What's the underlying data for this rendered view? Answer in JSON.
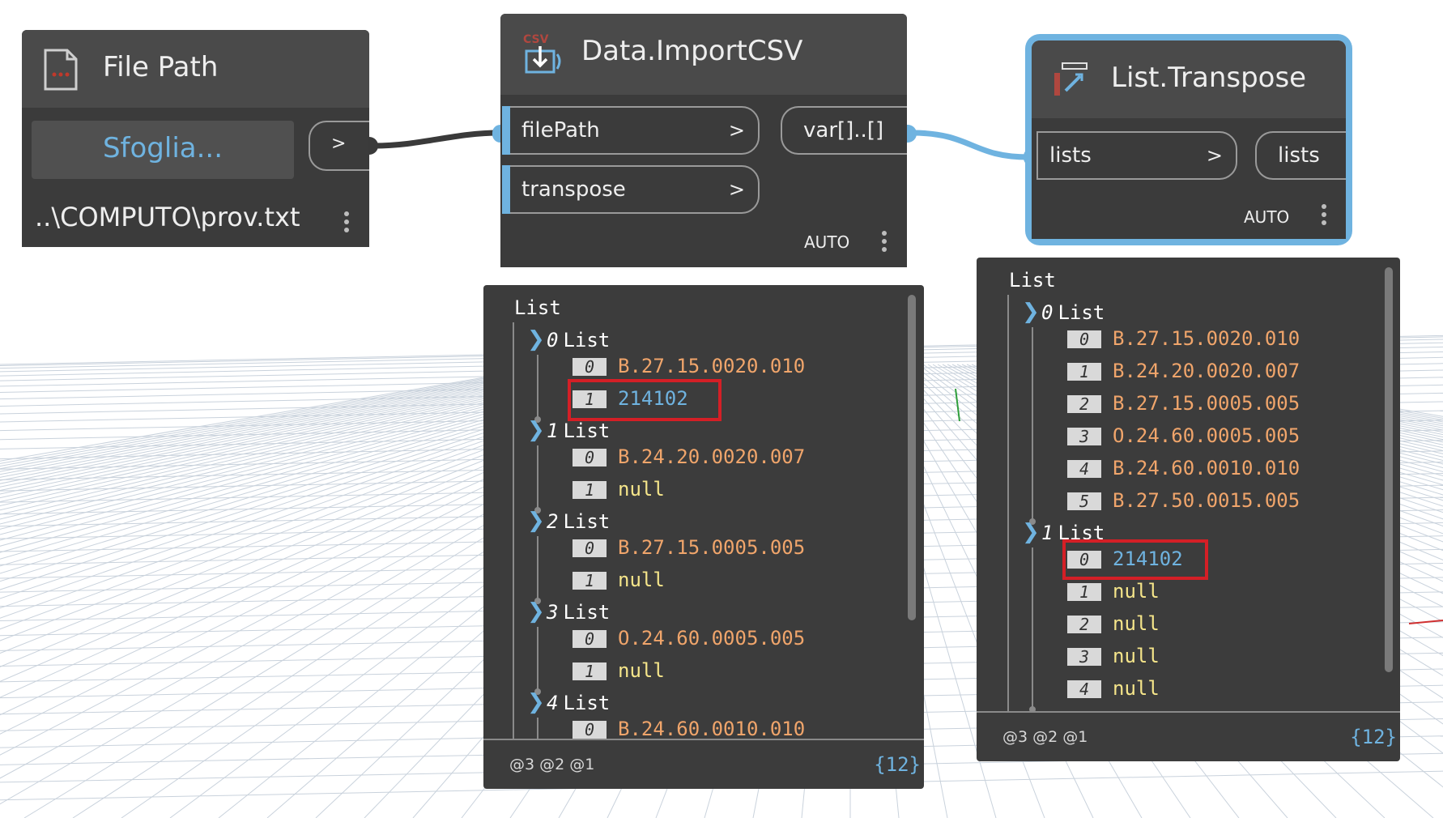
{
  "colors": {
    "node_body": "#3b3b3b",
    "node_header": "#4a4a4a",
    "selected_outline": "#6fb3e0",
    "string_value": "#f0a56b",
    "number_value": "#6fb3e0",
    "null_value": "#f5e58a",
    "highlight_box": "#d41f26"
  },
  "file_path_node": {
    "icon": "file-icon",
    "title": "File Path",
    "browse_button": "Sfoglia...",
    "output_chevron": ">",
    "path_value": "..\\COMPUTO\\prov.txt"
  },
  "import_csv_node": {
    "icon": "csv-import-icon",
    "icon_label": "CSV",
    "title": "Data.ImportCSV",
    "inputs": [
      {
        "name": "filePath",
        "chevron": ">"
      },
      {
        "name": "transpose",
        "chevron": ">"
      }
    ],
    "output": "var[]..[]",
    "lacing": "AUTO"
  },
  "transpose_node": {
    "icon": "list-transpose-icon",
    "title": "List.Transpose",
    "input": {
      "name": "lists",
      "chevron": ">"
    },
    "output": "lists",
    "lacing": "AUTO"
  },
  "import_preview": {
    "root_label": "List",
    "sublists": [
      {
        "index": "0",
        "label": "List",
        "items": [
          {
            "index": "0",
            "value": "B.27.15.0020.010",
            "kind": "string"
          },
          {
            "index": "1",
            "value": "214102",
            "kind": "number"
          }
        ]
      },
      {
        "index": "1",
        "label": "List",
        "items": [
          {
            "index": "0",
            "value": "B.24.20.0020.007",
            "kind": "string"
          },
          {
            "index": "1",
            "value": "null",
            "kind": "null"
          }
        ]
      },
      {
        "index": "2",
        "label": "List",
        "items": [
          {
            "index": "0",
            "value": "B.27.15.0005.005",
            "kind": "string"
          },
          {
            "index": "1",
            "value": "null",
            "kind": "null"
          }
        ]
      },
      {
        "index": "3",
        "label": "List",
        "items": [
          {
            "index": "0",
            "value": "O.24.60.0005.005",
            "kind": "string"
          },
          {
            "index": "1",
            "value": "null",
            "kind": "null"
          }
        ]
      },
      {
        "index": "4",
        "label": "List",
        "items": [
          {
            "index": "0",
            "value": "B.24.60.0010.010",
            "kind": "string"
          }
        ]
      }
    ],
    "levels": "@3 @2 @1",
    "count": "{12}"
  },
  "transpose_preview": {
    "root_label": "List",
    "sublists": [
      {
        "index": "0",
        "label": "List",
        "items": [
          {
            "index": "0",
            "value": "B.27.15.0020.010",
            "kind": "string"
          },
          {
            "index": "1",
            "value": "B.24.20.0020.007",
            "kind": "string"
          },
          {
            "index": "2",
            "value": "B.27.15.0005.005",
            "kind": "string"
          },
          {
            "index": "3",
            "value": "O.24.60.0005.005",
            "kind": "string"
          },
          {
            "index": "4",
            "value": "B.24.60.0010.010",
            "kind": "string"
          },
          {
            "index": "5",
            "value": "B.27.50.0015.005",
            "kind": "string"
          }
        ]
      },
      {
        "index": "1",
        "label": "List",
        "items": [
          {
            "index": "0",
            "value": "214102",
            "kind": "number"
          },
          {
            "index": "1",
            "value": "null",
            "kind": "null"
          },
          {
            "index": "2",
            "value": "null",
            "kind": "null"
          },
          {
            "index": "3",
            "value": "null",
            "kind": "null"
          },
          {
            "index": "4",
            "value": "null",
            "kind": "null"
          }
        ]
      }
    ],
    "levels": "@3 @2 @1",
    "count": "{12}"
  }
}
